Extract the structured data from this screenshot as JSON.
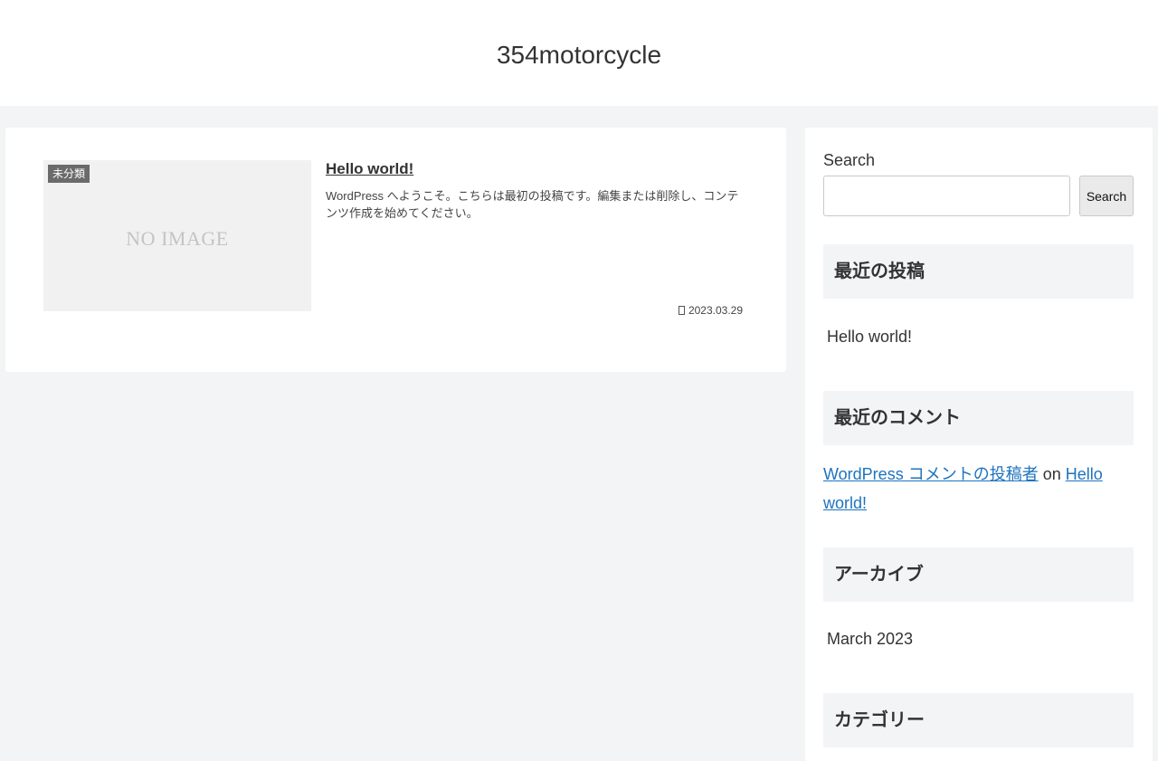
{
  "header": {
    "site_title": "354motorcycle"
  },
  "post": {
    "thumbnail_text": "NO IMAGE",
    "category_badge": "未分類",
    "title": "Hello world!",
    "snippet": "WordPress へようこそ。こちらは最初の投稿です。編集または削除し、コンテンツ作成を始めてください。",
    "date": "2023.03.29",
    "date_icon": "clock-icon"
  },
  "sidebar": {
    "search": {
      "label": "Search",
      "placeholder": "",
      "button_label": "Search"
    },
    "recent_posts": {
      "heading": "最近の投稿",
      "items": [
        "Hello world!"
      ]
    },
    "recent_comments": {
      "heading": "最近のコメント",
      "author": "WordPress コメントの投稿者",
      "connector": "on",
      "post": "Hello world!"
    },
    "archives": {
      "heading": "アーカイブ",
      "items": [
        "March 2023"
      ]
    },
    "categories": {
      "heading": "カテゴリー"
    }
  },
  "colors": {
    "page_background": "#f3f4f6",
    "card_background": "#ffffff",
    "link": "#1e73be",
    "badge": "#6b6b6b"
  }
}
